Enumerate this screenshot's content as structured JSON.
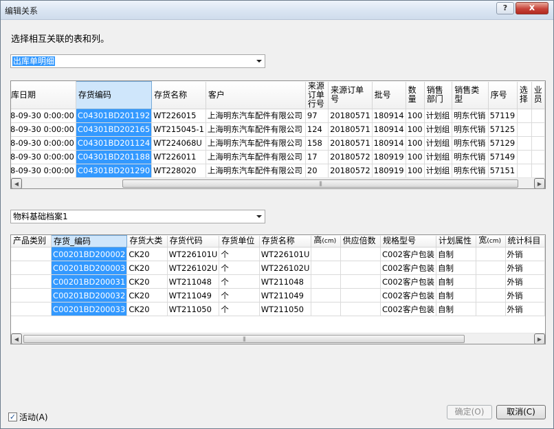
{
  "window": {
    "title": "编辑关系",
    "help_label": "?",
    "close_label": "x"
  },
  "prompt": "选择相互关联的表和列。",
  "combo1": {
    "value": "出库单明细"
  },
  "combo2": {
    "value": "物料基础档案1"
  },
  "grid1": {
    "headers": [
      "库日期",
      "存货编码",
      "存货名称",
      "客户",
      "来源订单行号",
      "来源订单号",
      "批号",
      "数量",
      "销售部门",
      "销售类型",
      "序号",
      "选择",
      "业员"
    ],
    "rows": [
      [
        "8-09-30 0:00:00",
        "C04301BD201192",
        "WT226015",
        "上海明东汽车配件有限公司",
        "97",
        "20180571",
        "180914",
        "100",
        "计划组",
        "明东代销",
        "57119",
        "",
        ""
      ],
      [
        "8-09-30 0:00:00",
        "C04301BD202165",
        "WT215045-1",
        "上海明东汽车配件有限公司",
        "124",
        "20180571",
        "180914",
        "100",
        "计划组",
        "明东代销",
        "57125",
        "",
        ""
      ],
      [
        "8-09-30 0:00:00",
        "C04301BD201124",
        "WT224068U",
        "上海明东汽车配件有限公司",
        "158",
        "20180571",
        "180914",
        "100",
        "计划组",
        "明东代销",
        "57129",
        "",
        ""
      ],
      [
        "8-09-30 0:00:00",
        "C04301BD201188",
        "WT226011",
        "上海明东汽车配件有限公司",
        "17",
        "20180572",
        "180919",
        "100",
        "计划组",
        "明东代销",
        "57149",
        "",
        ""
      ],
      [
        "8-09-30 0:00:00",
        "C04301BD201290",
        "WT228020",
        "上海明东汽车配件有限公司",
        "20",
        "20180572",
        "180919",
        "100",
        "计划组",
        "明东代销",
        "57151",
        "",
        ""
      ]
    ]
  },
  "grid2": {
    "headers": [
      "产品类别",
      "存货_编码",
      "存货大类",
      "存货代码",
      "存货单位",
      "存货名称",
      "高",
      "供应倍数",
      "规格型号",
      "计划属性",
      "宽",
      "统计科目"
    ],
    "unit": "(cm)",
    "rows": [
      [
        "",
        "C00201BD200002",
        "CK20",
        "WT226101U",
        "个",
        "WT226101U",
        "",
        "",
        "C002客户包装",
        "自制",
        "",
        "外销"
      ],
      [
        "",
        "C00201BD200003",
        "CK20",
        "WT226102U",
        "个",
        "WT226102U",
        "",
        "",
        "C002客户包装",
        "自制",
        "",
        "外销"
      ],
      [
        "",
        "C00201BD200031",
        "CK20",
        "WT211048",
        "个",
        "WT211048",
        "",
        "",
        "C002客户包装",
        "自制",
        "",
        "外销"
      ],
      [
        "",
        "C00201BD200032",
        "CK20",
        "WT211049",
        "个",
        "WT211049",
        "",
        "",
        "C002客户包装",
        "自制",
        "",
        "外销"
      ],
      [
        "",
        "C00201BD200033",
        "CK20",
        "WT211050",
        "个",
        "WT211050",
        "",
        "",
        "C002客户包装",
        "自制",
        "",
        "外销"
      ]
    ]
  },
  "active_checkbox": {
    "label": "活动(A)",
    "checked": true
  },
  "ok_button": {
    "label": "确定(O)"
  },
  "cancel_button": {
    "label": "取消(C)"
  },
  "icons": {
    "left_arrow": "◀",
    "right_arrow": "▶",
    "grip": "|||",
    "check": "✓"
  }
}
